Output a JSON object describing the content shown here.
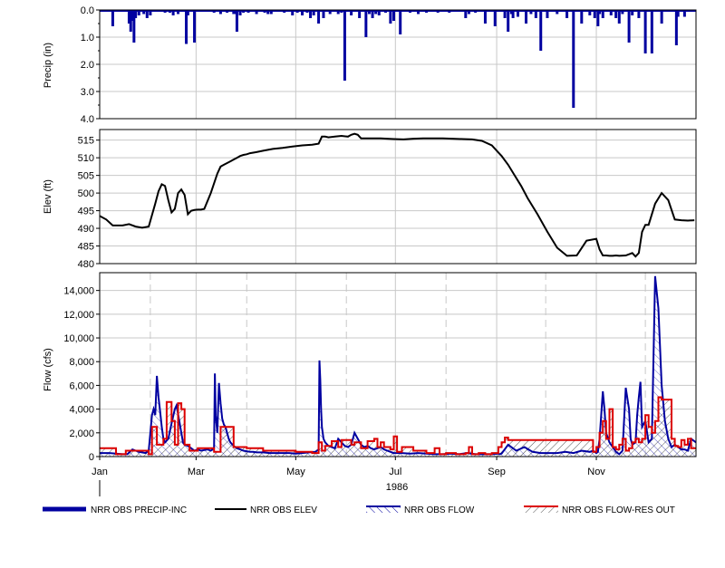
{
  "chart_data": [
    {
      "type": "bar",
      "ylabel": "Precip (in)",
      "yticks": [
        "0.0",
        "1.0",
        "2.0",
        "3.0",
        "4.0"
      ],
      "ylim": [
        0,
        4
      ],
      "inverted": true,
      "series_name": "NRR OBS PRECIP-INC",
      "color": "#0000a0",
      "x_days": [
        8,
        18,
        19,
        20,
        21,
        22,
        24,
        27,
        29,
        31,
        40,
        43,
        45,
        48,
        53,
        54,
        58,
        70,
        74,
        78,
        82,
        83,
        84,
        86,
        88,
        91,
        96,
        101,
        103,
        105,
        113,
        118,
        121,
        124,
        127,
        129,
        131,
        134,
        137,
        141,
        146,
        148,
        150,
        154,
        159,
        163,
        165,
        167,
        169,
        171,
        175,
        178,
        180,
        184,
        190,
        195,
        200,
        207,
        214,
        224,
        226,
        230,
        236,
        242,
        248,
        250,
        252,
        253,
        256,
        261,
        264,
        267,
        270,
        274,
        280,
        286,
        290,
        295,
        300,
        303,
        305,
        306,
        308,
        313,
        316,
        318,
        320,
        324,
        326,
        330,
        334,
        338,
        344,
        353,
        354,
        358
      ],
      "values": [
        0.6,
        0.5,
        0.8,
        0.4,
        1.2,
        0.3,
        0.2,
        0.15,
        0.3,
        0.2,
        0.1,
        0.1,
        0.2,
        0.15,
        1.25,
        0.2,
        1.2,
        0.1,
        0.15,
        0.1,
        0.15,
        0.15,
        0.8,
        0.2,
        0.1,
        0.1,
        0.15,
        0.1,
        0.15,
        0.15,
        0.1,
        0.2,
        0.1,
        0.2,
        0.1,
        0.3,
        0.2,
        0.5,
        0.3,
        0.15,
        0.15,
        0.1,
        2.6,
        0.2,
        0.3,
        1.0,
        0.15,
        0.3,
        0.15,
        0.2,
        0.1,
        0.5,
        0.4,
        0.9,
        0.1,
        0.15,
        0.1,
        0.1,
        0.1,
        0.3,
        0.15,
        0.1,
        0.5,
        0.6,
        0.3,
        0.8,
        0.15,
        0.3,
        0.25,
        0.5,
        0.15,
        0.3,
        1.5,
        0.3,
        0.15,
        0.3,
        3.6,
        0.5,
        0.2,
        0.3,
        0.6,
        0.15,
        0.3,
        0.2,
        0.3,
        0.5,
        0.15,
        1.2,
        0.2,
        0.3,
        1.6,
        1.6,
        0.5,
        1.3,
        0.25,
        0.25,
        1.0,
        1.7,
        1.2,
        0.3,
        0.5,
        0.4
      ]
    },
    {
      "type": "line",
      "ylabel": "Elev (ft)",
      "yticks": [
        "480",
        "485",
        "490",
        "495",
        "500",
        "505",
        "510",
        "515"
      ],
      "ylim": [
        480,
        518
      ],
      "series_name": "NRR OBS ELEV",
      "color": "#000000",
      "x_days": [
        0,
        4,
        8,
        14,
        18,
        22,
        26,
        30,
        34,
        36,
        38,
        40,
        42,
        44,
        46,
        48,
        50,
        52,
        54,
        56,
        58,
        60,
        62,
        64,
        68,
        72,
        74,
        76,
        78,
        80,
        82,
        84,
        86,
        88,
        90,
        92,
        96,
        100,
        106,
        112,
        118,
        124,
        130,
        134,
        136,
        138,
        140,
        144,
        148,
        152,
        154,
        156,
        158,
        160,
        164,
        168,
        172,
        176,
        180,
        186,
        192,
        198,
        204,
        210,
        216,
        222,
        228,
        234,
        240,
        244,
        246,
        250,
        254,
        258,
        262,
        268,
        274,
        280,
        286,
        292,
        298,
        304,
        306,
        308,
        310,
        312,
        314,
        316,
        318,
        322,
        326,
        328,
        330,
        332,
        334,
        336,
        340,
        344,
        348,
        352,
        356,
        360,
        364
      ],
      "values": [
        493.5,
        492.5,
        490.8,
        490.8,
        491.2,
        490.5,
        490.2,
        490.5,
        497.0,
        500.5,
        502.5,
        502.0,
        498.0,
        494.5,
        495.5,
        500.0,
        501.0,
        499.5,
        494.0,
        495.0,
        495.2,
        495.3,
        495.3,
        495.5,
        500.0,
        505.5,
        507.5,
        508.0,
        508.5,
        509.0,
        509.5,
        510.0,
        510.5,
        510.8,
        511.0,
        511.3,
        511.6,
        512.0,
        512.5,
        512.8,
        513.2,
        513.5,
        513.7,
        514.0,
        516.0,
        516.0,
        515.8,
        516.0,
        516.2,
        516.0,
        516.5,
        516.8,
        516.5,
        515.5,
        515.5,
        515.5,
        515.5,
        515.4,
        515.3,
        515.2,
        515.4,
        515.5,
        515.5,
        515.5,
        515.4,
        515.3,
        515.2,
        514.8,
        513.5,
        511.5,
        510.5,
        508.0,
        505.0,
        502.0,
        498.5,
        494.0,
        489.0,
        484.5,
        482.2,
        482.3,
        486.5,
        487.0,
        484.0,
        482.3,
        482.3,
        482.2,
        482.2,
        482.3,
        482.2,
        482.3,
        483.0,
        482.0,
        483.0,
        489.0,
        491.0,
        491.0,
        497.0,
        500.0,
        498.0,
        492.5,
        492.3,
        492.2,
        492.3
      ]
    },
    {
      "type": "line",
      "ylabel": "Flow (cfs)",
      "yticks": [
        "0",
        "2,000",
        "4,000",
        "6,000",
        "8,000",
        "10,000",
        "12,000",
        "14,000"
      ],
      "ylim": [
        0,
        15500
      ],
      "xaxis": {
        "labels": [
          "Jan",
          "Mar",
          "May",
          "Jul",
          "Sep",
          "Nov"
        ],
        "label_days": [
          0,
          59,
          120,
          181,
          243,
          304
        ],
        "year": "1986",
        "xlim": [
          0,
          365
        ]
      },
      "grid": true,
      "series": [
        {
          "name": "NRR OBS FLOW",
          "color": "#0000a0",
          "x_days": [
            0,
            6,
            10,
            14,
            17,
            20,
            24,
            28,
            30,
            32,
            33,
            34,
            35,
            36,
            37,
            38,
            39,
            40,
            42,
            44,
            46,
            47,
            48,
            49,
            50,
            51,
            52,
            54,
            56,
            58,
            60,
            62,
            64,
            66,
            68,
            70,
            70.5,
            71,
            72,
            73,
            74,
            75,
            76,
            77,
            78,
            79,
            80,
            82,
            84,
            86,
            88,
            90,
            92,
            94,
            96,
            100,
            104,
            108,
            112,
            116,
            120,
            124,
            128,
            132,
            134,
            134.5,
            135,
            135.5,
            136,
            137,
            138,
            140,
            142,
            144,
            146,
            148,
            150,
            152,
            154,
            156,
            158,
            160,
            162,
            164,
            166,
            168,
            170,
            172,
            174,
            176,
            178,
            180,
            185,
            190,
            195,
            200,
            205,
            210,
            215,
            220,
            225,
            230,
            235,
            240,
            244,
            245,
            246,
            250,
            255,
            260,
            265,
            270,
            275,
            280,
            285,
            290,
            295,
            300,
            302,
            304,
            305,
            306,
            307,
            308,
            309,
            310,
            312,
            314,
            315,
            316,
            317,
            318,
            320,
            322,
            324,
            325,
            326,
            328,
            329,
            330,
            331,
            332,
            334,
            336,
            338,
            340,
            342,
            344,
            346,
            348,
            350,
            352,
            354,
            356,
            358,
            360,
            362,
            365
          ],
          "values": [
            300,
            300,
            250,
            200,
            200,
            600,
            400,
            300,
            500,
            3500,
            4000,
            3500,
            6800,
            5000,
            3800,
            2500,
            1500,
            1200,
            1500,
            2800,
            4000,
            4300,
            3600,
            2800,
            2000,
            1200,
            1000,
            900,
            700,
            500,
            600,
            500,
            550,
            600,
            500,
            700,
            7000,
            3500,
            2000,
            6200,
            4500,
            3200,
            2700,
            2500,
            2000,
            1500,
            1200,
            900,
            700,
            600,
            500,
            450,
            400,
            400,
            350,
            350,
            300,
            300,
            300,
            300,
            250,
            300,
            350,
            400,
            600,
            8100,
            6500,
            4000,
            2500,
            1500,
            1200,
            900,
            800,
            700,
            1500,
            1200,
            900,
            800,
            1000,
            2000,
            1500,
            1000,
            800,
            900,
            700,
            600,
            700,
            800,
            600,
            500,
            400,
            300,
            300,
            250,
            300,
            250,
            200,
            200,
            250,
            200,
            300,
            200,
            200,
            200,
            250,
            200,
            250,
            1000,
            500,
            800,
            400,
            300,
            300,
            300,
            400,
            300,
            500,
            400,
            500,
            300,
            400,
            1500,
            3500,
            5500,
            4000,
            2000,
            1200,
            800,
            600,
            400,
            300,
            200,
            500,
            5800,
            4000,
            1500,
            1000,
            1200,
            3500,
            5000,
            6300,
            2500,
            3000,
            1200,
            1500,
            15200,
            12500,
            6000,
            3000,
            1500,
            800,
            1000,
            800,
            600,
            600,
            500,
            1500,
            1200,
            900,
            800,
            700
          ]
        },
        {
          "name": "NRR OBS FLOW-RES OUT",
          "color": "#dc0000",
          "x_days": [
            0,
            10,
            10,
            16,
            16,
            30,
            30,
            32,
            32,
            35,
            35,
            39,
            39,
            41,
            41,
            44,
            44,
            46,
            46,
            48,
            48,
            50,
            50,
            52,
            52,
            55,
            55,
            60,
            60,
            70,
            70,
            74,
            74,
            82,
            82,
            90,
            90,
            100,
            100,
            120,
            120,
            130,
            130,
            134,
            134,
            136,
            136,
            138,
            138,
            142,
            142,
            146,
            146,
            148,
            148,
            154,
            154,
            156,
            156,
            160,
            160,
            164,
            164,
            168,
            168,
            170,
            170,
            172,
            172,
            174,
            174,
            178,
            178,
            180,
            180,
            182,
            182,
            185,
            185,
            192,
            192,
            200,
            200,
            205,
            205,
            208,
            208,
            212,
            212,
            218,
            218,
            224,
            224,
            226,
            226,
            228,
            228,
            232,
            232,
            236,
            236,
            240,
            240,
            244,
            244,
            246,
            246,
            248,
            248,
            250,
            250,
            300,
            300,
            302,
            302,
            304,
            304,
            306,
            306,
            308,
            308,
            310,
            310,
            312,
            312,
            314,
            314,
            316,
            316,
            318,
            318,
            320,
            320,
            322,
            322,
            324,
            324,
            326,
            326,
            328,
            328,
            330,
            330,
            332,
            332,
            334,
            334,
            336,
            336,
            338,
            338,
            340,
            340,
            342,
            342,
            344,
            344,
            350,
            350,
            352,
            352,
            354,
            354,
            356,
            356,
            358,
            358,
            360,
            360,
            362,
            362,
            365
          ],
          "values": [
            700,
            700,
            200,
            200,
            500,
            500,
            200,
            200,
            2500,
            2500,
            1000,
            1000,
            1500,
            1500,
            4600,
            4600,
            3000,
            3000,
            1000,
            1000,
            4500,
            4500,
            4000,
            4000,
            1000,
            1000,
            500,
            500,
            700,
            700,
            400,
            400,
            2500,
            2500,
            800,
            800,
            700,
            700,
            500,
            500,
            400,
            400,
            300,
            300,
            1200,
            1200,
            500,
            500,
            900,
            900,
            1300,
            1300,
            800,
            800,
            1400,
            1400,
            1000,
            1000,
            1200,
            1200,
            700,
            700,
            1300,
            1300,
            1500,
            1500,
            800,
            800,
            1200,
            1200,
            800,
            800,
            600,
            600,
            1700,
            1700,
            400,
            400,
            800,
            800,
            500,
            500,
            300,
            300,
            700,
            700,
            200,
            200,
            300,
            300,
            200,
            200,
            300,
            300,
            800,
            800,
            200,
            200,
            300,
            300,
            200,
            200,
            300,
            300,
            800,
            800,
            1200,
            1200,
            1600,
            1600,
            1400,
            1400,
            1400,
            1400,
            400,
            400,
            800,
            800,
            2000,
            2000,
            3000,
            3000,
            1500,
            1500,
            4000,
            4000,
            800,
            800,
            600,
            600,
            1000,
            1000,
            1500,
            1500,
            500,
            500,
            700,
            700,
            1200,
            1200,
            1500,
            1500,
            1200,
            1200,
            1500,
            1500,
            3500,
            3500,
            2500,
            2500,
            2000,
            2000,
            3000,
            3000,
            5000,
            5000,
            4800,
            4800,
            1500,
            1500,
            900,
            900,
            800,
            800,
            1400,
            1400,
            1000,
            1000,
            1500,
            1500,
            700,
            700,
            600
          ]
        }
      ]
    }
  ],
  "legend": [
    {
      "label": "NRR OBS PRECIP-INC",
      "color": "#0000a0",
      "style": "thick"
    },
    {
      "label": "NRR OBS ELEV",
      "color": "#000000",
      "style": "line"
    },
    {
      "label": "NRR OBS FLOW",
      "color": "#0000a0",
      "style": "hatch"
    },
    {
      "label": "NRR OBS FLOW-RES OUT",
      "color": "#dc0000",
      "style": "hatch"
    }
  ]
}
